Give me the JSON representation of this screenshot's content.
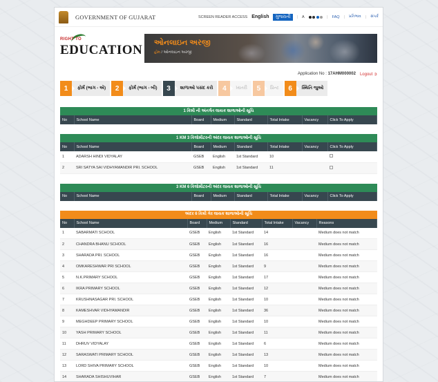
{
  "topbar": {
    "gov_title": "GOVERNMENT OF GUJARAT",
    "screen_reader": "SCREEN READER ACCESS",
    "lang_en": "English",
    "lang_gu": "ગુજરાતી",
    "font_size": "A",
    "faq": "FAQ",
    "contact": "પ્રતિભાવ",
    "register": "સંપર્ક"
  },
  "header": {
    "logo_small": "RIGHT TO",
    "logo_big": "EDUCATION",
    "banner_title": "ઓનલાઇન અરજી",
    "banner_home": "હોમ",
    "banner_current": "ઓનલાઇન અરજી"
  },
  "app": {
    "app_no_label": "Application No :",
    "app_no": "17AHM000002",
    "logout": "Logout"
  },
  "steps": [
    {
      "num": "1",
      "label": "ફોર્મ (ભાગ - એ)",
      "state": "done"
    },
    {
      "num": "2",
      "label": "ફોર્મ (ભાગ - બી)",
      "state": "done"
    },
    {
      "num": "3",
      "label": "શાળાઓ પસંદ કરો",
      "state": "current"
    },
    {
      "num": "4",
      "label": "ખાતરી",
      "state": "off"
    },
    {
      "num": "5",
      "label": "પ્રિન્ટ",
      "state": "off"
    },
    {
      "num": "6",
      "label": "સ્થિતિ જુઓ",
      "state": "final"
    }
  ],
  "table1": {
    "title": "1 કિમી ની અંતર્ગત લાયક શાળાઓની સૂચિ",
    "headers": [
      "No",
      "School Name",
      "Board",
      "Medium",
      "Standard",
      "Total Intake",
      "Vacancy",
      "Click To Apply"
    ]
  },
  "table2": {
    "title": "1 KM 3 કિલોમીટરની અંદર લાયક શાળાઓની સૂચિ",
    "headers": [
      "No",
      "School Name",
      "Board",
      "Medium",
      "Standard",
      "Total Intake",
      "Vacancy",
      "Click To Apply"
    ],
    "rows": [
      {
        "no": "1",
        "name": "ADARSH HINDI VIDYALAY",
        "board": "GSEB",
        "medium": "English",
        "standard": "1st Standard",
        "intake": "10"
      },
      {
        "no": "2",
        "name": "SRI SATYA SAI VIDHYAMANDIR PRI. SCHOOL",
        "board": "GSEB",
        "medium": "English",
        "standard": "1st Standard",
        "intake": "11"
      }
    ]
  },
  "table3": {
    "title": "3 KM 6 કિલોમીટરની અંદર લાયક શાળાઓની સૂચિ",
    "headers": [
      "No",
      "School Name",
      "Board",
      "Medium",
      "Standard",
      "Total Intake",
      "Vacancy",
      "Click To Apply"
    ]
  },
  "table4": {
    "title": "અંદર 6 કિમી ગેર લાયક શાળાઓની સૂચિ",
    "headers": [
      "No",
      "School Name",
      "Board",
      "Medium",
      "Standard",
      "Total Intake",
      "Vacancy",
      "Reasons"
    ],
    "rows": [
      {
        "no": "1",
        "name": "SABARMATI SCHOOL",
        "board": "GSEB",
        "medium": "English",
        "standard": "1st Standard",
        "intake": "14",
        "reason": "Medium does not match"
      },
      {
        "no": "2",
        "name": "CHANDRA BHANU SCHOOL",
        "board": "GSEB",
        "medium": "English",
        "standard": "1st Standard",
        "intake": "16",
        "reason": "Medium does not match"
      },
      {
        "no": "3",
        "name": "SHARADA PRI. SCHOOL",
        "board": "GSEB",
        "medium": "English",
        "standard": "1st Standard",
        "intake": "16",
        "reason": "Medium does not match"
      },
      {
        "no": "4",
        "name": "OMKARESHWAR PRI SCHOOL",
        "board": "GSEB",
        "medium": "English",
        "standard": "1st Standard",
        "intake": "9",
        "reason": "Medium does not match"
      },
      {
        "no": "5",
        "name": "N.K.PRIMARY SCHOOL",
        "board": "GSEB",
        "medium": "English",
        "standard": "1st Standard",
        "intake": "17",
        "reason": "Medium does not match"
      },
      {
        "no": "6",
        "name": "IKRA PRIMARY SCHOOL",
        "board": "GSEB",
        "medium": "English",
        "standard": "1st Standard",
        "intake": "12",
        "reason": "Medium does not match"
      },
      {
        "no": "7",
        "name": "KRUSHNASAGAR PRI. SCHOOL",
        "board": "GSEB",
        "medium": "English",
        "standard": "1st Standard",
        "intake": "10",
        "reason": "Medium does not match"
      },
      {
        "no": "8",
        "name": "KAMESHVAR VIDHYAMANDIR",
        "board": "GSEB",
        "medium": "English",
        "standard": "1st Standard",
        "intake": "36",
        "reason": "Medium does not match"
      },
      {
        "no": "9",
        "name": "MEGHDEEP PRIMARY SCHOOL",
        "board": "GSEB",
        "medium": "English",
        "standard": "1st Standard",
        "intake": "10",
        "reason": "Medium does not match"
      },
      {
        "no": "10",
        "name": "YASH PRIMARY SCHOOL",
        "board": "GSEB",
        "medium": "English",
        "standard": "1st Standard",
        "intake": "11",
        "reason": "Medium does not match"
      },
      {
        "no": "11",
        "name": "DHRUV VIDYALAY",
        "board": "GSEB",
        "medium": "English",
        "standard": "1st Standard",
        "intake": "6",
        "reason": "Medium does not match"
      },
      {
        "no": "12",
        "name": "SARASWATI PRIMARY SCHOOL",
        "board": "GSEB",
        "medium": "English",
        "standard": "1st Standard",
        "intake": "13",
        "reason": "Medium does not match"
      },
      {
        "no": "13",
        "name": "LORD SHIVA PRIMARY SCHOOL",
        "board": "GSEB",
        "medium": "English",
        "standard": "1st Standard",
        "intake": "10",
        "reason": "Medium does not match"
      },
      {
        "no": "14",
        "name": "SHARADA SHISHUVIHAR",
        "board": "GSEB",
        "medium": "English",
        "standard": "1st Standard",
        "intake": "7",
        "reason": "Medium does not match"
      }
    ]
  },
  "colors": {
    "accent_orange": "#f28c1a",
    "table_header": "#37474f",
    "section_green": "#2e8b57",
    "link_blue": "#1565c0",
    "logout_red": "#d32f2f"
  }
}
